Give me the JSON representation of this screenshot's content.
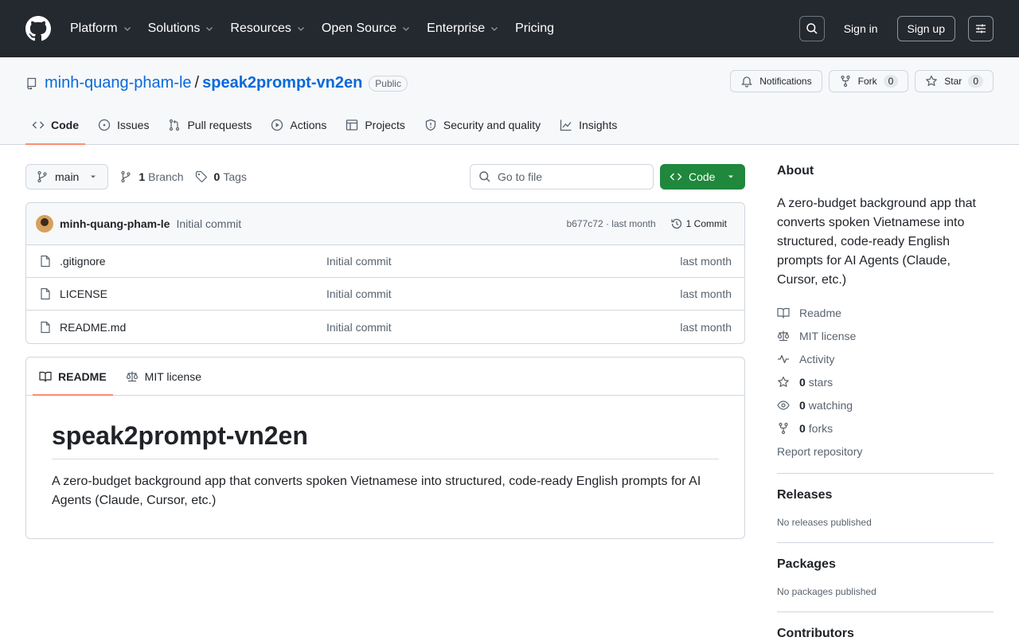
{
  "header": {
    "nav": [
      {
        "label": "Platform",
        "caret": true
      },
      {
        "label": "Solutions",
        "caret": true
      },
      {
        "label": "Resources",
        "caret": true
      },
      {
        "label": "Open Source",
        "caret": true
      },
      {
        "label": "Enterprise",
        "caret": true
      },
      {
        "label": "Pricing",
        "caret": false
      }
    ],
    "sign_in": "Sign in",
    "sign_up": "Sign up"
  },
  "repo": {
    "owner": "minh-quang-pham-le",
    "separator": "/",
    "name": "speak2prompt-vn2en",
    "visibility": "Public",
    "notifications_label": "Notifications",
    "fork_label": "Fork",
    "fork_count": "0",
    "star_label": "Star",
    "star_count": "0"
  },
  "tabs": [
    {
      "label": "Code",
      "icon": "code-icon",
      "active": true
    },
    {
      "label": "Issues",
      "icon": "issue-icon",
      "active": false
    },
    {
      "label": "Pull requests",
      "icon": "pull-request-icon",
      "active": false
    },
    {
      "label": "Actions",
      "icon": "play-icon",
      "active": false
    },
    {
      "label": "Projects",
      "icon": "table-icon",
      "active": false
    },
    {
      "label": "Security and quality",
      "icon": "shield-icon",
      "active": false
    },
    {
      "label": "Insights",
      "icon": "graph-icon",
      "active": false
    }
  ],
  "toolbar": {
    "branch": "main",
    "branch_count": "1",
    "branch_label": "Branch",
    "tag_count": "0",
    "tag_label": "Tags",
    "goto_placeholder": "Go to file",
    "code_button": "Code"
  },
  "latest_commit": {
    "author": "minh-quang-pham-le",
    "message": "Initial commit",
    "meta": "b677c72 · last month",
    "count_label": "1 Commit"
  },
  "files": [
    {
      "name": ".gitignore",
      "message": "Initial commit",
      "time": "last month"
    },
    {
      "name": "LICENSE",
      "message": "Initial commit",
      "time": "last month"
    },
    {
      "name": "README.md",
      "message": "Initial commit",
      "time": "last month"
    }
  ],
  "readme": {
    "tab_readme": "README",
    "tab_license": "MIT license",
    "title": "speak2prompt-vn2en",
    "body": "A zero-budget background app that converts spoken Vietnamese into structured, code-ready English prompts for AI Agents (Claude, Cursor, etc.)"
  },
  "sidebar": {
    "about_title": "About",
    "about_desc": "A zero-budget background app that converts spoken Vietnamese into structured, code-ready English prompts for AI Agents (Claude, Cursor, etc.)",
    "readme_link": "Readme",
    "license_link": "MIT license",
    "activity_link": "Activity",
    "stars_count": "0",
    "stars_label": "stars",
    "watching_count": "0",
    "watching_label": "watching",
    "forks_count": "0",
    "forks_label": "forks",
    "report": "Report repository",
    "releases_title": "Releases",
    "releases_note": "No releases published",
    "packages_title": "Packages",
    "packages_note": "No packages published",
    "contributors_title": "Contributors"
  },
  "colors": {
    "header_bg": "#24292f",
    "accent_link": "#0969da",
    "code_button": "#1f883d",
    "active_tab": "#fd8c73"
  }
}
